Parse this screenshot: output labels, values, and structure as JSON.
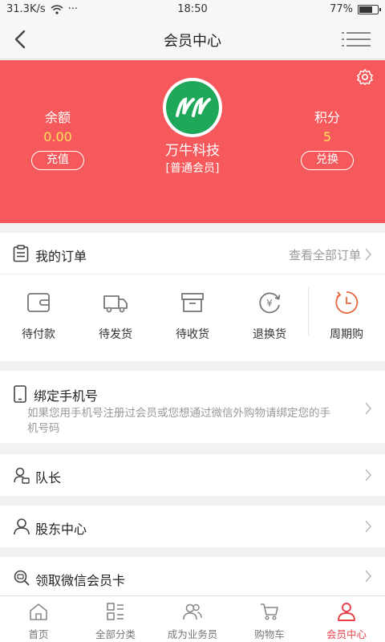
{
  "status_bar": {
    "speed": "31.3K/s",
    "dots": "···",
    "time": "18:50",
    "battery": "77%",
    "battery_level": 0.77
  },
  "header": {
    "title": "会员中心"
  },
  "profile": {
    "name": "万牛科技",
    "level": "[普通会员]",
    "balance_label": "余额",
    "balance_value": "0.00",
    "recharge_label": "充值",
    "points_label": "积分",
    "points_value": "5",
    "exchange_label": "兑换",
    "accent_bg": "#f6595b",
    "value_color": "#ffe15a"
  },
  "orders": {
    "title": "我的订单",
    "view_all": "查看全部订单",
    "items": [
      {
        "label": "待付款",
        "icon": "wallet-icon"
      },
      {
        "label": "待发货",
        "icon": "truck-icon"
      },
      {
        "label": "待收货",
        "icon": "box-icon"
      },
      {
        "label": "退换货",
        "icon": "refund-icon"
      },
      {
        "label": "周期购",
        "icon": "clock-icon"
      }
    ]
  },
  "bind_phone": {
    "title": "绑定手机号",
    "desc": "如果您用手机号注册过会员或您想通过微信外购物请绑定您的手机号码"
  },
  "menu": {
    "captain": "队长",
    "shareholder": "股东中心",
    "wechat_card": "领取微信会员卡"
  },
  "tabbar": {
    "items": [
      {
        "label": "首页"
      },
      {
        "label": "全部分类"
      },
      {
        "label": "成为业务员"
      },
      {
        "label": "购物车"
      },
      {
        "label": "会员中心"
      }
    ],
    "active_color": "#e8424b"
  }
}
